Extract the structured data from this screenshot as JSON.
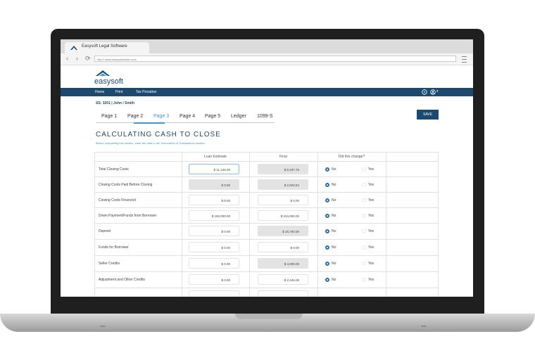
{
  "browser": {
    "tab_title": "Easysoft Legal Software",
    "url": "http:// www.easysoftonline.com/"
  },
  "app": {
    "logo_text": "easysoft",
    "nav": [
      "Home",
      "Print",
      "Tax Proration"
    ],
    "case_id": "SS- 3201  |  John  / Smith",
    "page_tabs": [
      "Page 1",
      "Page 2",
      "Page 3",
      "Page 4",
      "Page 5",
      "Ledger",
      "1099-S"
    ],
    "active_tab": "Page 3",
    "save_label": "SAVE",
    "section_title": "CALCULATING CASH TO CLOSE",
    "section_subtitle": "Before completing this section, enter the data in the Summaries of Transactions section."
  },
  "table": {
    "headers": [
      "Loan Estimate",
      "Final",
      "Did this change?"
    ],
    "option_no": "No",
    "option_yes": "Yes",
    "rows": [
      {
        "label": "Total Closing Costs",
        "estimate": "$ 11,146.00",
        "final": "$ 9,197.75",
        "changed": "No"
      },
      {
        "label": "Closing Costs Paid Before Closing",
        "estimate": "$ 0.00",
        "final": "$ 2,820.84",
        "changed": "No"
      },
      {
        "label": "Closing Costs Financed",
        "estimate": "$ 0.00",
        "final": "$ 0.00",
        "changed": "No"
      },
      {
        "label": "Down Payment/Funds from Borrower",
        "estimate": "$ 150,000.00",
        "final": "$ 104,000.00",
        "changed": "No"
      },
      {
        "label": "Deposit",
        "estimate": "$ 0.00",
        "final": "$ 26,750.00",
        "changed": "No"
      },
      {
        "label": "Funds for Borrower",
        "estimate": "$ 0.00",
        "final": "$ 0.00",
        "changed": "No"
      },
      {
        "label": "Seller Credits",
        "estimate": "$ 0.00",
        "final": "$ 4,000.00",
        "changed": "No"
      },
      {
        "label": "Adjustment and Other Credits",
        "estimate": "$ 0.00",
        "final": "-$ 2,446.08",
        "changed": "No"
      }
    ]
  },
  "colors": {
    "brand": "#1c4a6e",
    "accent": "#3d96d6",
    "radio": "#2a6fb0"
  }
}
